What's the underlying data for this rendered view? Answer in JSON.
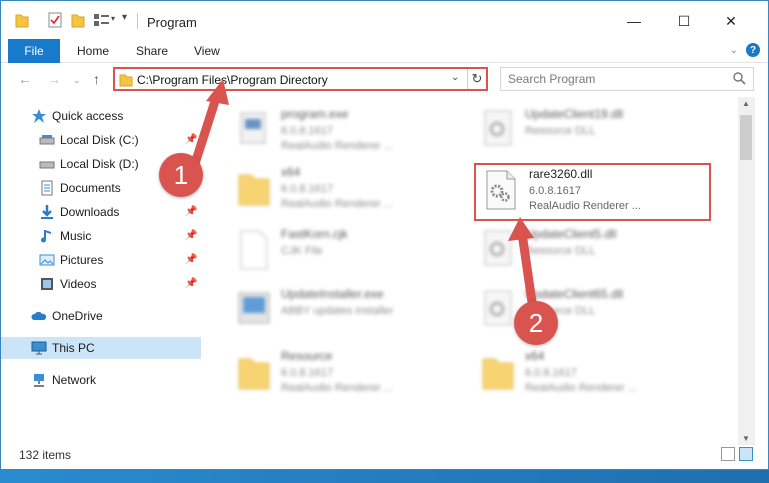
{
  "window": {
    "title": "Program",
    "controls": {
      "minimize": "—",
      "maximize": "☐",
      "close": "✕"
    }
  },
  "ribbon": {
    "tabs": [
      "File",
      "Home",
      "Share",
      "View"
    ]
  },
  "address": {
    "path": "C:\\Program Files\\Program Directory"
  },
  "search": {
    "placeholder": "Search Program"
  },
  "sidebar": {
    "items": [
      {
        "label": "Quick access",
        "icon": "star-icon",
        "pinned": false
      },
      {
        "label": "Local Disk (C:)",
        "icon": "drive-icon",
        "pinned": true
      },
      {
        "label": "Local Disk (D:)",
        "icon": "drive-icon",
        "pinned": false
      },
      {
        "label": "Documents",
        "icon": "documents-icon",
        "pinned": true
      },
      {
        "label": "Downloads",
        "icon": "downloads-icon",
        "pinned": true
      },
      {
        "label": "Music",
        "icon": "music-icon",
        "pinned": true
      },
      {
        "label": "Pictures",
        "icon": "pictures-icon",
        "pinned": true
      },
      {
        "label": "Videos",
        "icon": "videos-icon",
        "pinned": true
      },
      {
        "label": "OneDrive",
        "icon": "onedrive-icon",
        "pinned": false
      },
      {
        "label": "This PC",
        "icon": "pc-icon",
        "pinned": false,
        "selected": true
      },
      {
        "label": "Network",
        "icon": "network-icon",
        "pinned": false
      }
    ]
  },
  "files": [
    {
      "name": "program.exe",
      "version": "6.0.8.1617",
      "desc": "RealAudio Renderer ...",
      "icon": "exe-icon"
    },
    {
      "name": "UpdateClient19.dll",
      "version": "Resource DLL",
      "desc": "",
      "icon": "dll-icon"
    },
    {
      "name": "x64",
      "version": "6.0.8.1617",
      "desc": "RealAudio Renderer ...",
      "icon": "folder-icon"
    },
    {
      "name": "rare3260.dll",
      "version": "6.0.8.1617",
      "desc": "RealAudio Renderer ...",
      "icon": "dll-icon"
    },
    {
      "name": "FastKorn.cjk",
      "version": "CJK File",
      "desc": "",
      "icon": "file-icon"
    },
    {
      "name": "UpdateClient5.dll",
      "version": "Resource DLL",
      "desc": "",
      "icon": "dll-icon"
    },
    {
      "name": "UpdateInstaller.exe",
      "version": "ABBY updates installer",
      "desc": "",
      "icon": "installer-icon"
    },
    {
      "name": "UpdateClient65.dll",
      "version": "Resource DLL",
      "desc": "",
      "icon": "dll-icon"
    },
    {
      "name": "Resource",
      "version": "6.0.8.1617",
      "desc": "RealAudio Renderer ...",
      "icon": "folder-icon"
    },
    {
      "name": "x64",
      "version": "6.0.8.1617",
      "desc": "RealAudio Renderer ...",
      "icon": "folder-icon"
    }
  ],
  "status": {
    "item_count": "132 items"
  },
  "annotations": {
    "step1": "1",
    "step2": "2",
    "accent": "#d9534f"
  }
}
